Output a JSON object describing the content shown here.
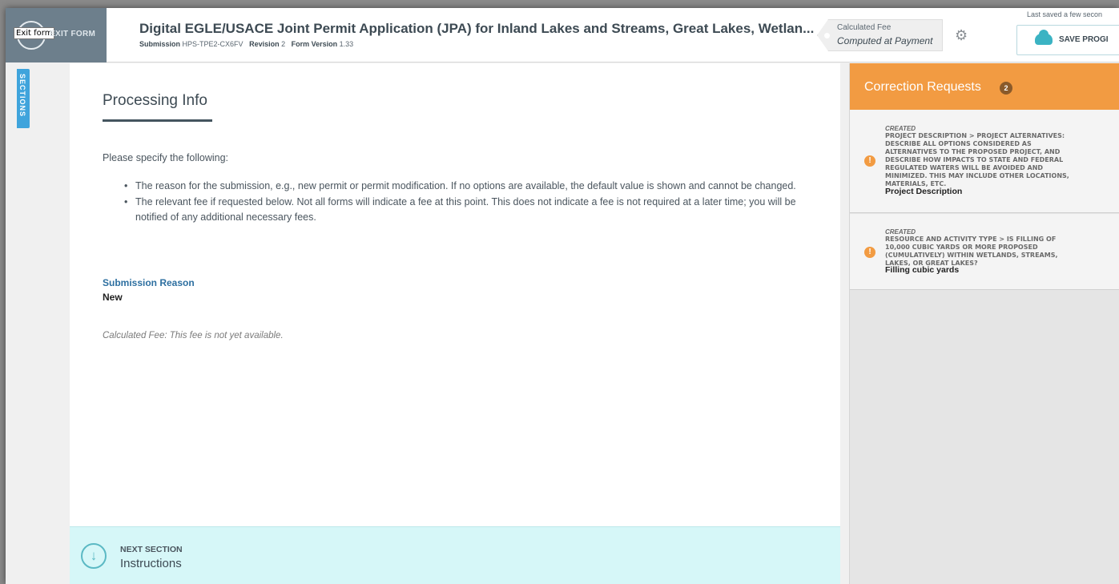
{
  "header": {
    "exit_tooltip": "Exit form",
    "exit_label": "EXIT FORM",
    "form_title": "Digital EGLE/USACE Joint Permit Application (JPA) for Inland Lakes and Streams, Great Lakes, Wetlan...",
    "submission_label": "Submission",
    "submission_id": "HPS-TPE2-CX6FV",
    "revision_label": "Revision",
    "revision_value": "2",
    "form_version_label": "Form Version",
    "form_version_value": "1.33",
    "fee_tag_label": "Calculated Fee",
    "fee_tag_value": "Computed at Payment",
    "gear_icon": "gear-icon",
    "last_saved": "Last saved a few secon",
    "save_label": "SAVE PROGI"
  },
  "sections_tab": {
    "label": "SECTIONS"
  },
  "main": {
    "title": "Processing Info",
    "intro": "Please specify the following:",
    "bullets": [
      "The reason for the submission, e.g., new permit or permit modification. If no options are available, the default value is shown and cannot be changed.",
      "The relevant fee if requested below. Not all forms will indicate a fee at this point. This does not indicate a fee is not required at a later time; you will be notified of any additional necessary fees."
    ],
    "submission_reason_label": "Submission Reason",
    "submission_reason_value": "New",
    "fee_note": "Calculated Fee: This fee is not yet available."
  },
  "next_section": {
    "kicker": "NEXT SECTION",
    "title": "Instructions",
    "icon": "arrow-down-circle-icon"
  },
  "correction_requests": {
    "title": "Correction Requests",
    "count": "2",
    "items": [
      {
        "status": "CREATED",
        "description": "PROJECT DESCRIPTION > PROJECT ALTERNATIVES: DESCRIBE ALL OPTIONS CONSIDERED AS ALTERNATIVES TO THE PROPOSED PROJECT, AND DESCRIBE HOW IMPACTS TO STATE AND FEDERAL REGULATED WATERS WILL BE AVOIDED AND MINIMIZED. THIS MAY INCLUDE OTHER LOCATIONS, MATERIALS, ETC.",
        "field": "Project Description"
      },
      {
        "status": "CREATED",
        "description": "RESOURCE AND ACTIVITY TYPE > IS FILLING OF 10,000 CUBIC YARDS OR MORE PROPOSED (CUMULATIVELY) WITHIN WETLANDS, STREAMS, LAKES, OR GREAT LAKES?",
        "field": "Filling cubic yards"
      }
    ]
  },
  "colors": {
    "accent_orange": "#f29b42",
    "sections_blue": "#3fa4dc",
    "next_section_bg": "#d6f7f8",
    "exit_block": "#6d7f8c"
  }
}
